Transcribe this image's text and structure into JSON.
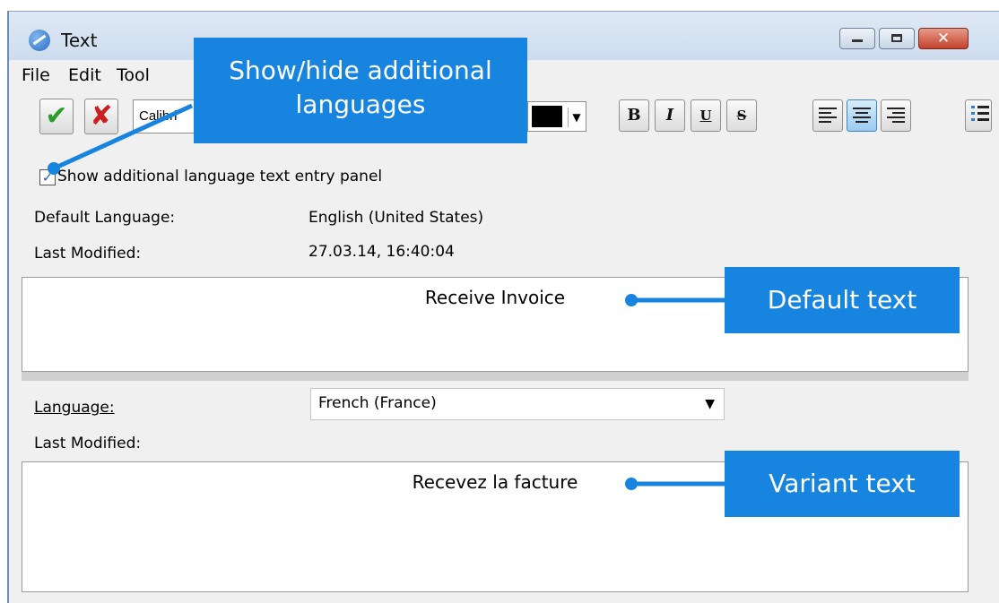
{
  "window": {
    "title": "Text",
    "controls": {
      "minimize_icon": "minimize-icon",
      "maximize_icon": "maximize-icon",
      "close_icon": "close-icon",
      "close_glyph": "✕"
    }
  },
  "menu": {
    "items": [
      "File",
      "Edit",
      "Tool"
    ]
  },
  "toolbar": {
    "ok_icon": "✔",
    "cancel_icon": "✘",
    "font_name": "Calibri",
    "font_color": "#000000",
    "bold_label": "B",
    "italic_label": "I",
    "underline_label": "U",
    "strike_label": "S"
  },
  "panel": {
    "show_additional_checkbox": {
      "label": "Show additional language text entry panel",
      "checked": true,
      "check_glyph": "✓"
    },
    "default_language_label": "Default Language:",
    "default_language_value": "English (United States)",
    "last_modified_label": "Last Modified:",
    "last_modified_value": "27.03.14, 16:40:04",
    "default_text": "Receive Invoice",
    "language_label": "Language:",
    "language_value": "French (France)",
    "variant_last_modified_label": "Last Modified:",
    "variant_text": "Recevez la facture"
  },
  "callouts": {
    "show_hide": [
      "Show/hide additional",
      "languages"
    ],
    "default_text": "Default text",
    "variant_text": "Variant text",
    "color": "#1784e0"
  }
}
